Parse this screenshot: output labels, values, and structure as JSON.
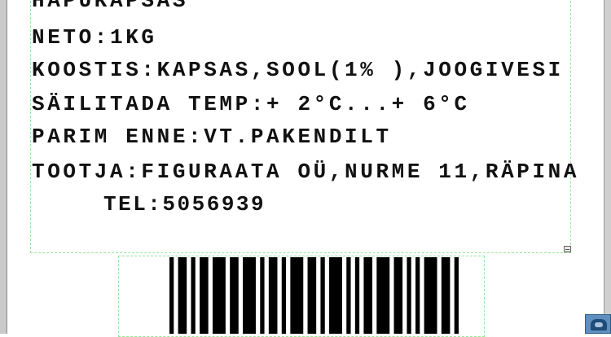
{
  "label": {
    "lines": [
      "HAPUKAPSAS",
      "NETO:1KG",
      "KOOSTIS:KAPSAS,SOOL(1% ),JOOGIVESI",
      "SÄILITADA TEMP:+ 2°C...+ 6°C",
      "PARIM ENNE:VT.PAKENDILT",
      "TOOTJA:FIGURAATA OÜ,NURME 11,RÄPINA",
      "TEL:5056939"
    ]
  },
  "barcode": {
    "bars": "1011010110111011011101011010111011010111010101101110110101011101101"
  },
  "icons": {
    "resize_handle": "resize-handle-icon",
    "corner_widget": "app-tray-icon"
  }
}
